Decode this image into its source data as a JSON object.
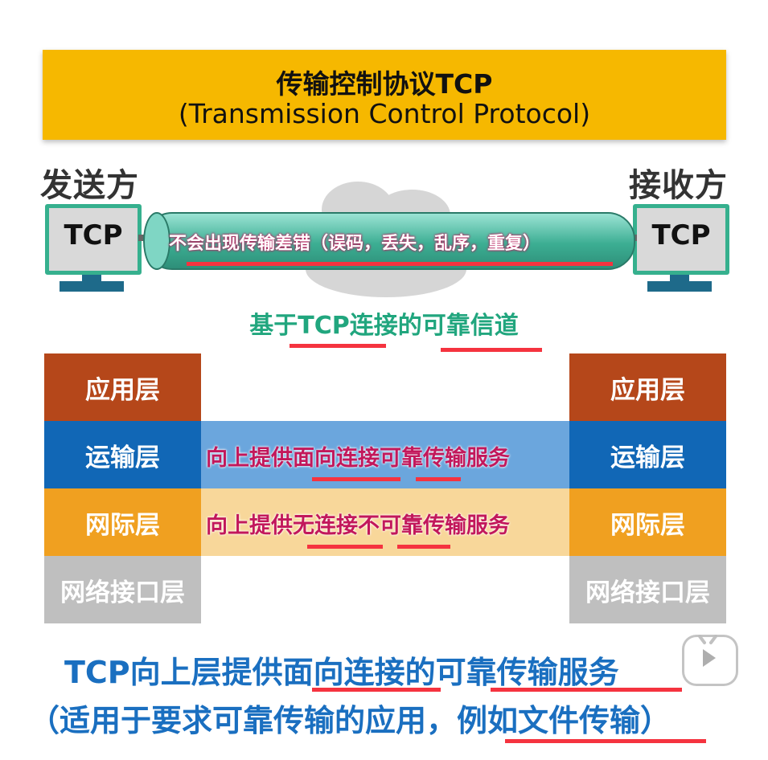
{
  "banner": {
    "title": "传输控制协议TCP",
    "subtitle": "(Transmission Control Protocol)"
  },
  "sender": {
    "label": "发送方",
    "screen": "TCP"
  },
  "receiver": {
    "label": "接收方",
    "screen": "TCP"
  },
  "pipe_text": "不会出现传输差错（误码，丢失，乱序，重复）",
  "channel_text": "基于TCP连接的可靠信道",
  "layers_left": [
    "应用层",
    "运输层",
    "网际层",
    "网络接口层"
  ],
  "layers_right": [
    "应用层",
    "运输层",
    "网际层",
    "网络接口层"
  ],
  "layer_colors": [
    "#b5471a",
    "#1167b6",
    "#f0a020",
    "#bfbfbf"
  ],
  "transport_service": "向上提供面向连接可靠传输服务",
  "network_service": "向上提供无连接不可靠传输服务",
  "summary_line1": "TCP向上层提供面向连接的可靠传输服务",
  "summary_line2": "（适用于要求可靠传输的应用，例如文件传输）",
  "play_icon": "play-icon"
}
